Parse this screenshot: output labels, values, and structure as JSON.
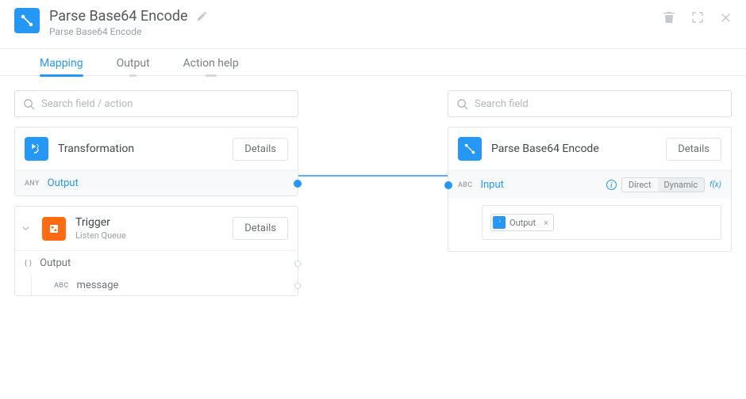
{
  "header": {
    "title": "Parse Base64 Encode",
    "subtitle": "Parse Base64 Encode"
  },
  "tabs": [
    "Mapping",
    "Output",
    "Action help"
  ],
  "left": {
    "search_placeholder": "Search field / action",
    "card1": {
      "title": "Transformation",
      "details": "Details",
      "output_badge": "ANY",
      "output_label": "Output"
    },
    "card2": {
      "title": "Trigger",
      "subtitle": "Listen Queue",
      "details": "Details",
      "out_badge": "{ }",
      "out_label": "Output",
      "msg_badge": "ABC",
      "msg_label": "message"
    }
  },
  "right": {
    "search_placeholder": "Search field",
    "card": {
      "title": "Parse Base64 Encode",
      "details": "Details",
      "input_badge": "ABC",
      "input_label": "Input",
      "seg_direct": "Direct",
      "seg_dynamic": "Dynamic",
      "fx": "f(x)",
      "chip_label": "Output"
    }
  }
}
